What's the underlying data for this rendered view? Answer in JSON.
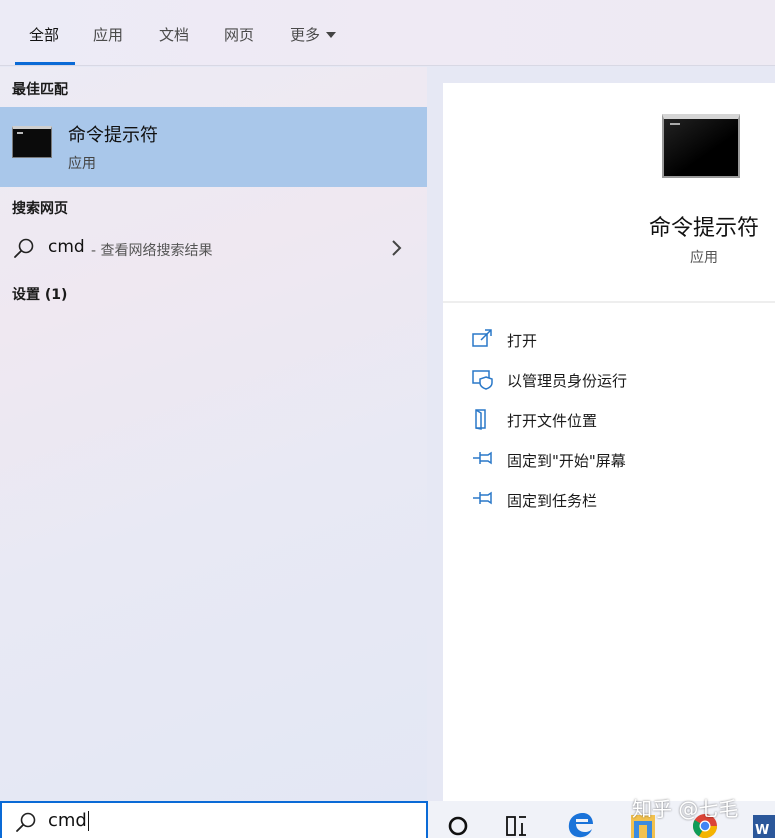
{
  "tabs": [
    {
      "label": "全部"
    },
    {
      "label": "应用"
    },
    {
      "label": "文档"
    },
    {
      "label": "网页"
    },
    {
      "label": "更多"
    }
  ],
  "left": {
    "best_match_title": "最佳匹配",
    "best_match": {
      "name": "命令提示符",
      "type": "应用"
    },
    "web_title": "搜索网页",
    "web_result": {
      "query": "cmd",
      "hint": "- 查看网络搜索结果"
    },
    "settings_title": "设置 (1)"
  },
  "detail": {
    "name": "命令提示符",
    "type": "应用",
    "actions": [
      {
        "label": "打开",
        "icon": "open-icon"
      },
      {
        "label": "以管理员身份运行",
        "icon": "admin-shield-icon"
      },
      {
        "label": "打开文件位置",
        "icon": "file-location-icon"
      },
      {
        "label": "固定到\"开始\"屏幕",
        "icon": "pin-icon"
      },
      {
        "label": "固定到任务栏",
        "icon": "pin-icon"
      }
    ]
  },
  "search": {
    "value": "cmd"
  },
  "taskbar": {
    "icons": [
      "cortana-icon",
      "task-view-icon",
      "edge-icon",
      "file-explorer-icon",
      "chrome-icon",
      "word-icon"
    ]
  },
  "watermark": "知乎 @七毛",
  "colors": {
    "accent": "#0a6ad6",
    "selected": "#a9c7ea",
    "icon_blue": "#2a78c8"
  }
}
